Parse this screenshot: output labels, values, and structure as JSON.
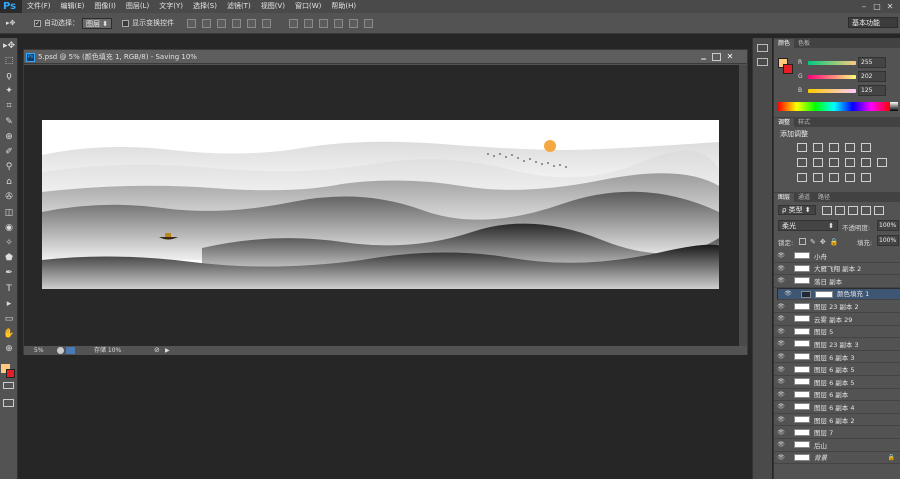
{
  "app": {
    "logo": "Ps"
  },
  "menus": [
    "文件(F)",
    "编辑(E)",
    "图像(I)",
    "图层(L)",
    "文字(Y)",
    "选择(S)",
    "滤镜(T)",
    "视图(V)",
    "窗口(W)",
    "帮助(H)"
  ],
  "window_controls": [
    "–",
    "□",
    "✕"
  ],
  "options": {
    "auto_select_label": "自动选择：",
    "auto_select_value": "图层",
    "show_transform_label": "显示变换控件",
    "workspace": "基本功能"
  },
  "tools": [
    "▸✥",
    "⬚",
    "ϙ",
    "✦",
    "⌗",
    "✎",
    "⊕",
    "✐",
    "⚲",
    "⌂",
    "✇",
    "◫",
    "◉",
    "✧",
    "⬟",
    "✒",
    "T",
    "▸",
    "▭",
    "✋",
    "⊕"
  ],
  "document": {
    "title": "5.psd @ 5% (颜色填充 1, RGB/8) - Saving 10%",
    "zoom": "5%",
    "save_status": "存储 10%"
  },
  "color_panel": {
    "tabs": [
      "颜色",
      "色板"
    ],
    "r_label": "R",
    "g_label": "G",
    "b_label": "B",
    "r": "255",
    "g": "202",
    "b": "125",
    "fg_color": "#ffca7d",
    "bg_color": "#e31e24"
  },
  "adjust_panel": {
    "tabs": [
      "调整",
      "样式"
    ],
    "title": "添加调整"
  },
  "layers_panel": {
    "tabs": [
      "图层",
      "通道",
      "路径"
    ],
    "filter_label": "类型",
    "blend_mode": "柔光",
    "opacity_label": "不透明度:",
    "opacity": "100%",
    "lock_label": "锁定:",
    "fill_label": "填充:",
    "fill": "100%",
    "layers": [
      {
        "name": "小舟",
        "selected": false
      },
      {
        "name": "大雁飞翔 副本 2",
        "selected": false
      },
      {
        "name": "落日 副本",
        "selected": false
      },
      {
        "name": "颜色填充 1",
        "selected": true
      },
      {
        "name": "图层 23 副本 2",
        "selected": false
      },
      {
        "name": "云雾 副本 29",
        "selected": false
      },
      {
        "name": "图层 5",
        "selected": false
      },
      {
        "name": "图层 23 副本 3",
        "selected": false
      },
      {
        "name": "图层 6 副本 3",
        "selected": false
      },
      {
        "name": "图层 6 副本 5",
        "selected": false
      },
      {
        "name": "图层 6 副本 5",
        "selected": false
      },
      {
        "name": "图层 6 副本",
        "selected": false
      },
      {
        "name": "图层 6 副本 4",
        "selected": false
      },
      {
        "name": "图层 6 副本 2",
        "selected": false
      },
      {
        "name": "图层 7",
        "selected": false
      },
      {
        "name": "后山",
        "selected": false
      },
      {
        "name": "背景",
        "selected": false
      }
    ]
  }
}
